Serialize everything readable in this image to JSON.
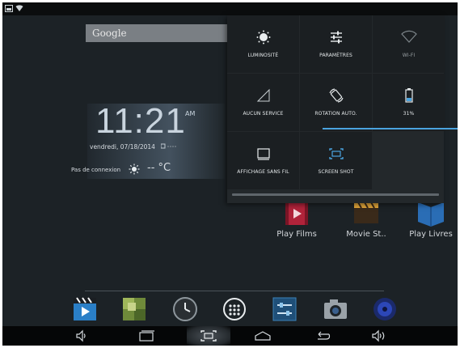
{
  "google_bar": {
    "label": "Google"
  },
  "clock": {
    "time": "11:21",
    "ampm": "AM",
    "date": "vendredi, 07/18/2014",
    "connection": "Pas de connexion",
    "temperature": "-- °C"
  },
  "quick_settings": {
    "tiles": [
      {
        "label": "LUMINOSITÉ",
        "icon": "brightness-icon"
      },
      {
        "label": "PARAMÈTRES",
        "icon": "settings-sliders-icon"
      },
      {
        "label": "WI-FI",
        "icon": "wifi-icon"
      },
      {
        "label": "AUCUN SERVICE",
        "icon": "no-signal-icon"
      },
      {
        "label": "ROTATION AUTO.",
        "icon": "auto-rotate-icon"
      },
      {
        "label": "31%",
        "icon": "battery-icon",
        "battery_level": 0.31
      },
      {
        "label": "AFFICHAGE SANS FIL",
        "icon": "cast-screen-icon"
      },
      {
        "label": "SCREEN SHOT",
        "icon": "screenshot-icon"
      }
    ]
  },
  "apps": [
    {
      "label": "Play Films",
      "icon": "play-films-icon"
    },
    {
      "label": "Movie St..",
      "icon": "movie-studio-icon"
    },
    {
      "label": "Play Livres",
      "icon": "play-livres-icon"
    }
  ],
  "dock": [
    {
      "icon": "video-app-icon"
    },
    {
      "icon": "gallery-app-icon"
    },
    {
      "icon": "clock-app-icon"
    },
    {
      "icon": "app-drawer-icon"
    },
    {
      "icon": "settings-app-icon"
    },
    {
      "icon": "camera-app-icon"
    },
    {
      "icon": "music-app-icon"
    }
  ],
  "nav_bar": [
    {
      "icon": "volume-down-icon"
    },
    {
      "icon": "recent-apps-icon"
    },
    {
      "icon": "screenshot-nav-icon"
    },
    {
      "icon": "home-icon"
    },
    {
      "icon": "back-icon"
    },
    {
      "icon": "volume-up-icon"
    }
  ],
  "colors": {
    "accent_blue": "#4aa3df",
    "panel_bg": "#23282b",
    "tile_bg": "#1b1f22"
  }
}
